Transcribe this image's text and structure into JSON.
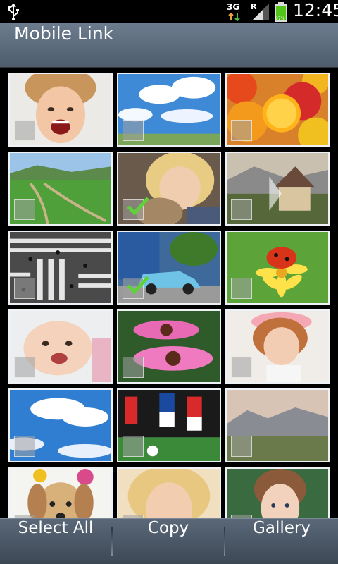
{
  "status_bar": {
    "usb_icon": "usb-icon",
    "network": "3G",
    "roaming": "R",
    "battery_label": "97%",
    "time": "12:45"
  },
  "title_bar": {
    "title": "Mobile Link"
  },
  "gallery": {
    "photos": [
      {
        "subject": "girl-laughing",
        "selected": false
      },
      {
        "subject": "blue-sky-clouds",
        "selected": false
      },
      {
        "subject": "citrus-fruits",
        "selected": false
      },
      {
        "subject": "green-valley-path",
        "selected": false
      },
      {
        "subject": "girl-with-teddy",
        "selected": true
      },
      {
        "subject": "village-house-mountains",
        "selected": false
      },
      {
        "subject": "crosswalk-crowd",
        "selected": false
      },
      {
        "subject": "blue-vintage-car",
        "selected": true
      },
      {
        "subject": "ladybug-on-flower",
        "selected": false
      },
      {
        "subject": "baby-smiling",
        "selected": false
      },
      {
        "subject": "pink-flowers",
        "selected": false
      },
      {
        "subject": "girl-on-phone",
        "selected": false
      },
      {
        "subject": "sky-and-clouds",
        "selected": false
      },
      {
        "subject": "soccer-players",
        "selected": false
      },
      {
        "subject": "mountain-landscape",
        "selected": false
      },
      {
        "subject": "puppy-with-balloons",
        "selected": false
      },
      {
        "subject": "smiling-woman",
        "selected": false
      },
      {
        "subject": "young-girl-portrait",
        "selected": false
      }
    ]
  },
  "bottom_bar": {
    "select_all": "Select All",
    "copy": "Copy",
    "gallery": "Gallery"
  }
}
